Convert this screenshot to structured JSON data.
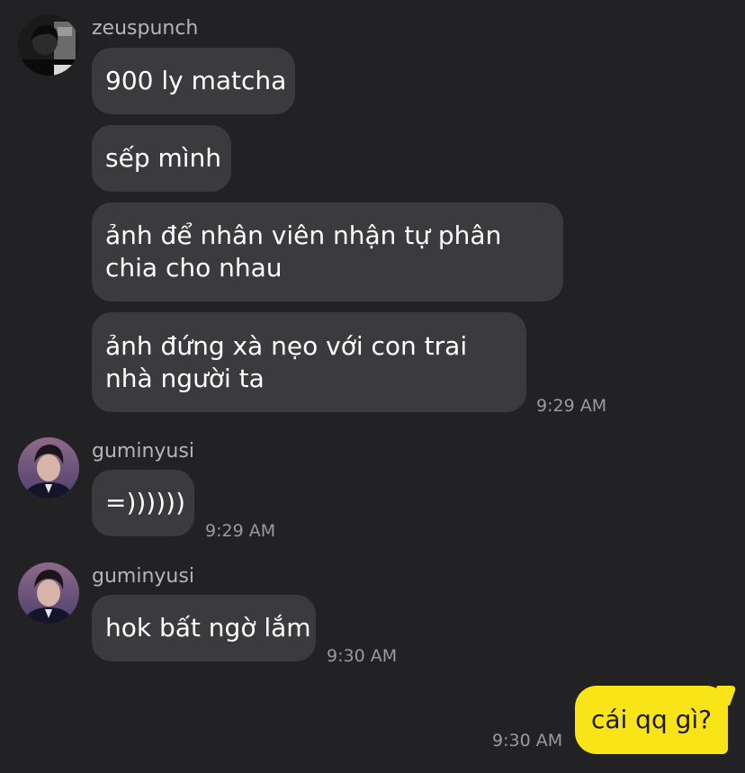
{
  "messages": {
    "group1": {
      "sender": "zeuspunch",
      "avatar_icon": "zeuspunch-avatar",
      "bubbles": [
        "900 ly matcha",
        "sếp mình",
        "ảnh để nhân viên nhận tự phân chia cho nhau",
        "ảnh đứng xà nẹo với con trai nhà người ta"
      ],
      "time": "9:29 AM"
    },
    "group2": {
      "sender": "guminyusi",
      "avatar_icon": "guminyusi-avatar",
      "bubbles": [
        "=))))))"
      ],
      "time": "9:29 AM"
    },
    "group3": {
      "sender": "guminyusi",
      "avatar_icon": "guminyusi-avatar",
      "bubbles": [
        "hok bất ngờ lắm"
      ],
      "time": "9:30 AM"
    },
    "outgoing": {
      "text": "cái qq gì?",
      "time": "9:30 AM"
    }
  },
  "colors": {
    "background": "#222224",
    "incoming_bubble": "#3b3b3e",
    "outgoing_bubble": "#f8e417"
  }
}
